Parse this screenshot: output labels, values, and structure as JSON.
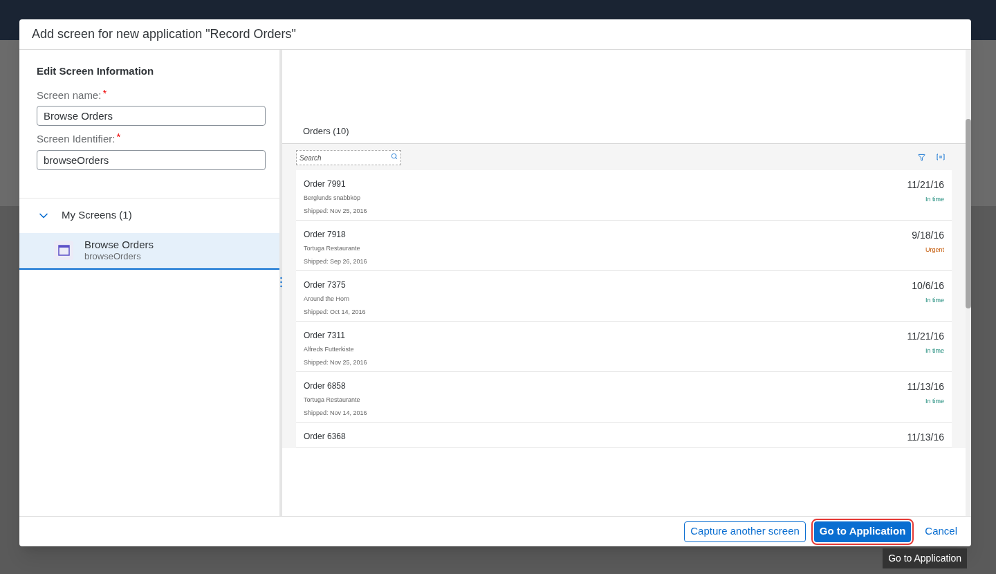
{
  "dialog": {
    "title": "Add screen for new application \"Record Orders\"",
    "form": {
      "heading": "Edit Screen Information",
      "required_mark": "*",
      "fields": [
        {
          "label": "Screen name:",
          "required": true,
          "value": "Browse Orders"
        },
        {
          "label": "Screen Identifier:",
          "required": true,
          "value": "browseOrders"
        }
      ]
    },
    "tree": {
      "label": "My Screens (1)",
      "expanded": true,
      "children": [
        {
          "title": "Browse Orders",
          "subtitle": "browseOrders",
          "selected": true
        }
      ]
    },
    "preview": {
      "title": "Orders (10)",
      "search": {
        "placeholder": "Search"
      },
      "orders": [
        {
          "title": "Order 7991",
          "customer": "Berglunds snabbköp",
          "shipped": "Shipped: Nov 25, 2016",
          "date": "11/21/16",
          "status": "In time",
          "kind": "ok"
        },
        {
          "title": "Order 7918",
          "customer": "Tortuga Restaurante",
          "shipped": "Shipped: Sep 26, 2016",
          "date": "9/18/16",
          "status": "Urgent",
          "kind": "urgent"
        },
        {
          "title": "Order 7375",
          "customer": "Around the Horn",
          "shipped": "Shipped: Oct 14, 2016",
          "date": "10/6/16",
          "status": "In time",
          "kind": "ok"
        },
        {
          "title": "Order 7311",
          "customer": "Alfreds Futterkiste",
          "shipped": "Shipped: Nov 25, 2016",
          "date": "11/21/16",
          "status": "In time",
          "kind": "ok"
        },
        {
          "title": "Order 6858",
          "customer": "Tortuga Restaurante",
          "shipped": "Shipped: Nov 14, 2016",
          "date": "11/13/16",
          "status": "In time",
          "kind": "ok"
        },
        {
          "title": "Order 6368",
          "date": "11/13/16",
          "kind": "cut"
        }
      ]
    },
    "buttons": [
      {
        "label": "Capture another screen",
        "kind": "secondary"
      },
      {
        "label": "Go to Application",
        "kind": "primary"
      },
      {
        "label": "Cancel",
        "kind": "link"
      }
    ],
    "tooltip": "Go to Application"
  }
}
